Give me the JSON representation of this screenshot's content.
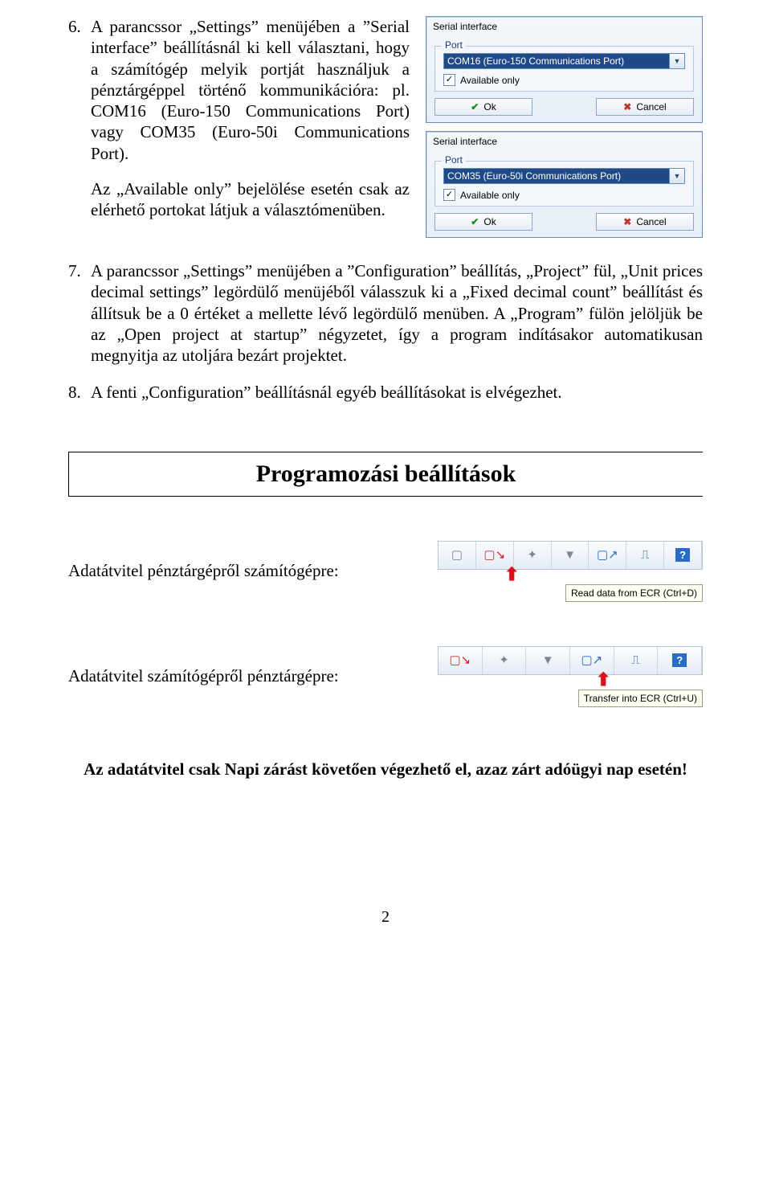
{
  "list": {
    "item6": {
      "num": "6.",
      "para1": "A parancssor „Settings” menüjében a ”Serial interface” beállításnál ki kell választani, hogy a számítógép melyik portját használjuk a pénztárgéppel történő kommunikációra: pl. COM16 (Euro-150 Communications Port) vagy COM35 (Euro-50i Communications Port).",
      "para2": "Az „Available only” bejelölése esetén csak az elérhető portokat látjuk a választómenüben."
    },
    "item7": {
      "num": "7.",
      "para": "A parancssor „Settings” menüjében a ”Configuration” beállítás, „Project” fül, „Unit prices decimal settings” legördülő menüjéből válasszuk ki a „Fixed decimal count” beállítást és állítsuk be a 0 értéket a mellette lévő legördülő menüben. A „Program” fülön jelöljük be az „Open project at startup” négyzetet, így a program indításakor automatikusan megnyitja az utoljára bezárt projektet."
    },
    "item8": {
      "num": "8.",
      "para": "A fenti „Configuration” beállításnál egyéb beállításokat is elvégezhet."
    }
  },
  "dialogs": {
    "title": "Serial interface",
    "group_label": "Port",
    "port1": "COM16 (Euro-150 Communications Port)",
    "port2": "COM35 (Euro-50i Communications Port)",
    "available_only": "Available only",
    "ok": "Ok",
    "cancel": "Cancel"
  },
  "section_title": "Programozási beállítások",
  "transfer": {
    "label1": "Adatátvitel pénztárgépről számítógépre:",
    "label2": "Adatátvitel számítógépről pénztárgépre:",
    "tooltip1": "Read data from ECR (Ctrl+D)",
    "tooltip2": "Transfer into ECR (Ctrl+U)"
  },
  "closing": "Az adatátvitel csak Napi zárást követően végezhető el, azaz zárt adóügyi nap esetén!",
  "page_number": "2"
}
